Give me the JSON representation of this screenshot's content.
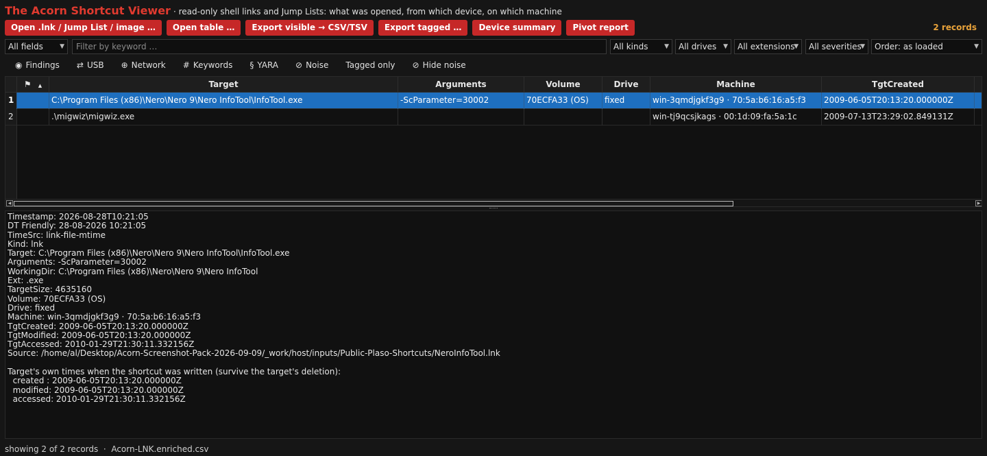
{
  "app": {
    "title": "The Acorn Shortcut Viewer",
    "subtitle": "· read-only shell links and Jump Lists: what was opened, from which device, on which machine"
  },
  "toolbar": {
    "buttons": [
      "Open .lnk / Jump List / image …",
      "Open table …",
      "Export visible → CSV/TSV",
      "Export tagged …",
      "Device summary",
      "Pivot report"
    ],
    "records_count": "2 records"
  },
  "filters": {
    "field": "All fields",
    "keyword_placeholder": "Filter by keyword …",
    "kinds": "All kinds",
    "drives": "All drives",
    "extensions": "All extensions",
    "severities": "All severities",
    "order": "Order: as loaded"
  },
  "toggles": [
    {
      "icon": "◉",
      "label": "Findings"
    },
    {
      "icon": "⇄",
      "label": "USB"
    },
    {
      "icon": "⊕",
      "label": "Network"
    },
    {
      "icon": "#",
      "label": "Keywords"
    },
    {
      "icon": "§",
      "label": "YARA"
    },
    {
      "icon": "⊘",
      "label": "Noise"
    },
    {
      "icon": "",
      "label": "Tagged only"
    },
    {
      "icon": "⊘",
      "label": "Hide noise"
    }
  ],
  "table": {
    "flag_header": "⚑",
    "sort_indicator": "▲",
    "columns": [
      "Target",
      "Arguments",
      "Volume",
      "Drive",
      "Machine",
      "TgtCreated"
    ],
    "rows": [
      {
        "num": "1",
        "target": "C:\\Program Files (x86)\\Nero\\Nero 9\\Nero InfoTool\\InfoTool.exe",
        "arguments": "-ScParameter=30002",
        "volume": "70ECFA33 (OS)",
        "drive": "fixed",
        "machine": "win-3qmdjgkf3g9 · 70:5a:b6:16:a5:f3",
        "tgtcreated": "2009-06-05T20:13:20.000000Z"
      },
      {
        "num": "2",
        "target": ".\\migwiz\\migwiz.exe",
        "arguments": "",
        "volume": "",
        "drive": "",
        "machine": "win-tj9qcsjkags · 00:1d:09:fa:5a:1c",
        "tgtcreated": "2009-07-13T23:29:02.849131Z"
      }
    ],
    "selected_row": 0
  },
  "detail": {
    "lines": [
      "Timestamp: 2026-08-28T10:21:05",
      "DT Friendly: 28-08-2026 10:21:05",
      "TimeSrc: link-file-mtime",
      "Kind: lnk",
      "Target: C:\\Program Files (x86)\\Nero\\Nero 9\\Nero InfoTool\\InfoTool.exe",
      "Arguments: -ScParameter=30002",
      "WorkingDir: C:\\Program Files (x86)\\Nero\\Nero 9\\Nero InfoTool",
      "Ext: .exe",
      "TargetSize: 4635160",
      "Volume: 70ECFA33 (OS)",
      "Drive: fixed",
      "Machine: win-3qmdjgkf3g9 · 70:5a:b6:16:a5:f3",
      "TgtCreated: 2009-06-05T20:13:20.000000Z",
      "TgtModified: 2009-06-05T20:13:20.000000Z",
      "TgtAccessed: 2010-01-29T21:30:11.332156Z",
      "Source: /home/al/Desktop/Acorn-Screenshot-Pack-2026-09-09/_work/host/inputs/Public-Plaso-Shortcuts/NeroInfoTool.lnk",
      "",
      "Target's own times when the shortcut was written (survive the target's deletion):",
      "  created : 2009-06-05T20:13:20.000000Z",
      "  modified: 2009-06-05T20:13:20.000000Z",
      "  accessed: 2010-01-29T21:30:11.332156Z"
    ]
  },
  "status": {
    "text": "showing 2 of 2 records  ·  Acorn-LNK.enriched.csv"
  }
}
